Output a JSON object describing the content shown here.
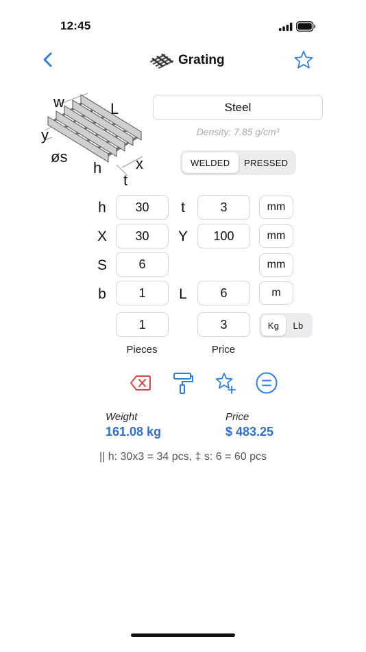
{
  "status": {
    "time": "12:45"
  },
  "nav": {
    "title": "Grating",
    "back_icon": "chevron-left-icon",
    "favorite_icon": "star-outline-icon"
  },
  "colors": {
    "accent": "#2f7de1",
    "delete": "#d64545",
    "result": "#2f6fd3",
    "placeholder": "#a9a9ad"
  },
  "diagram": {
    "labels": {
      "w": "w",
      "L": "L",
      "y": "y",
      "s": "øs",
      "h": "h",
      "x": "x",
      "t": "t"
    }
  },
  "material": {
    "name": "Steel",
    "density": "Density: 7.85 g/cm³"
  },
  "type_segment": {
    "options": [
      "WELDED",
      "PRESSED"
    ],
    "selected": "WELDED"
  },
  "rows": [
    {
      "label1": "h",
      "value1": "30",
      "label2": "t",
      "value2": "3",
      "unit": "mm"
    },
    {
      "label1": "X",
      "value1": "30",
      "label2": "Y",
      "value2": "100",
      "unit": "mm"
    },
    {
      "label1": "S",
      "value1": "6",
      "unit": "mm"
    },
    {
      "label1": "b",
      "value1": "1",
      "label2": "L",
      "value2": "6",
      "unit": "m"
    }
  ],
  "quantity": {
    "pieces": "1",
    "price": "3",
    "pieces_label": "Pieces",
    "price_label": "Price"
  },
  "weight_unit": {
    "options": [
      "Kg",
      "Lb"
    ],
    "selected": "Kg"
  },
  "actions": [
    "clear-icon",
    "paint-roller-icon",
    "star-add-icon",
    "equals-icon"
  ],
  "results": {
    "weight_label": "Weight",
    "weight_value": "161.08  kg",
    "price_label": "Price",
    "price_value": "$ 483.25",
    "summary": "|| h: 30x3 = 34 pcs, ‡ s: 6 = 60 pcs"
  }
}
